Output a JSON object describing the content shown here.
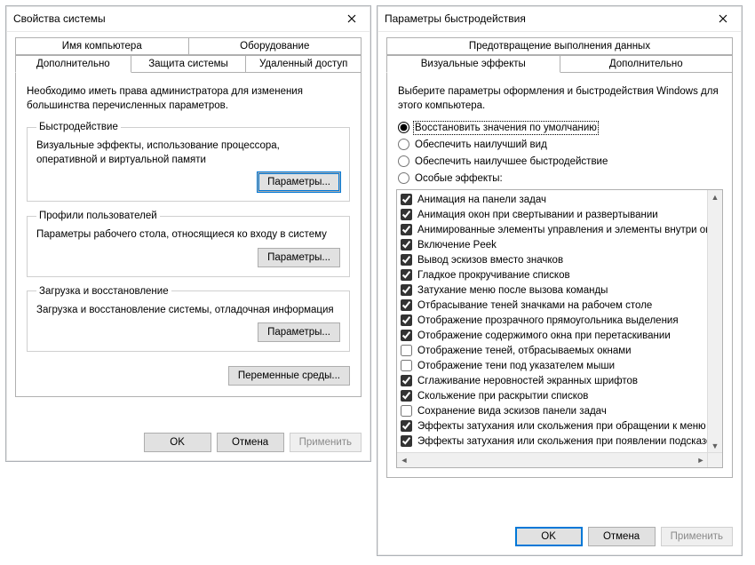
{
  "leftWin": {
    "title": "Свойства системы",
    "tabsTop": [
      "Имя компьютера",
      "Оборудование"
    ],
    "tabsBottom": [
      "Дополнительно",
      "Защита системы",
      "Удаленный доступ"
    ],
    "activeTab": "Дополнительно",
    "intro": "Необходимо иметь права администратора для изменения большинства перечисленных параметров.",
    "groups": {
      "perf": {
        "legend": "Быстродействие",
        "desc": "Визуальные эффекты, использование процессора, оперативной и виртуальной памяти",
        "button": "Параметры..."
      },
      "profiles": {
        "legend": "Профили пользователей",
        "desc": "Параметры рабочего стола, относящиеся ко входу в систему",
        "button": "Параметры..."
      },
      "startup": {
        "legend": "Загрузка и восстановление",
        "desc": "Загрузка и восстановление системы, отладочная информация",
        "button": "Параметры..."
      }
    },
    "envButton": "Переменные среды...",
    "buttons": {
      "ok": "OK",
      "cancel": "Отмена",
      "apply": "Применить"
    }
  },
  "rightWin": {
    "title": "Параметры быстродействия",
    "tabsTop": [
      "Предотвращение выполнения данных"
    ],
    "tabsBottom": [
      "Визуальные эффекты",
      "Дополнительно"
    ],
    "activeTab": "Визуальные эффекты",
    "instr": "Выберите параметры оформления и быстродействия Windows для этого компьютера.",
    "radios": [
      {
        "label": "Восстановить значения по умолчанию",
        "checked": true
      },
      {
        "label": "Обеспечить наилучший вид",
        "checked": false
      },
      {
        "label": "Обеспечить наилучшее быстродействие",
        "checked": false
      },
      {
        "label": "Особые эффекты:",
        "checked": false
      }
    ],
    "effects": [
      {
        "label": "Анимация на панели задач",
        "checked": true
      },
      {
        "label": "Анимация окон при свертывании и развертывании",
        "checked": true
      },
      {
        "label": "Анимированные элементы управления и элементы внутри окна",
        "checked": true
      },
      {
        "label": "Включение Peek",
        "checked": true
      },
      {
        "label": "Вывод эскизов вместо значков",
        "checked": true
      },
      {
        "label": "Гладкое прокручивание списков",
        "checked": true
      },
      {
        "label": "Затухание меню после вызова команды",
        "checked": true
      },
      {
        "label": "Отбрасывание теней значками на рабочем столе",
        "checked": true
      },
      {
        "label": "Отображение прозрачного прямоугольника выделения",
        "checked": true
      },
      {
        "label": "Отображение содержимого окна при перетаскивании",
        "checked": true
      },
      {
        "label": "Отображение теней, отбрасываемых окнами",
        "checked": false
      },
      {
        "label": "Отображение тени под указателем мыши",
        "checked": false
      },
      {
        "label": "Сглаживание неровностей экранных шрифтов",
        "checked": true
      },
      {
        "label": "Скольжение при раскрытии списков",
        "checked": true
      },
      {
        "label": "Сохранение вида эскизов панели задач",
        "checked": false
      },
      {
        "label": "Эффекты затухания или скольжения при обращении к меню",
        "checked": true
      },
      {
        "label": "Эффекты затухания или скольжения при появлении подсказок",
        "checked": true
      }
    ],
    "buttons": {
      "ok": "OK",
      "cancel": "Отмена",
      "apply": "Применить"
    }
  }
}
